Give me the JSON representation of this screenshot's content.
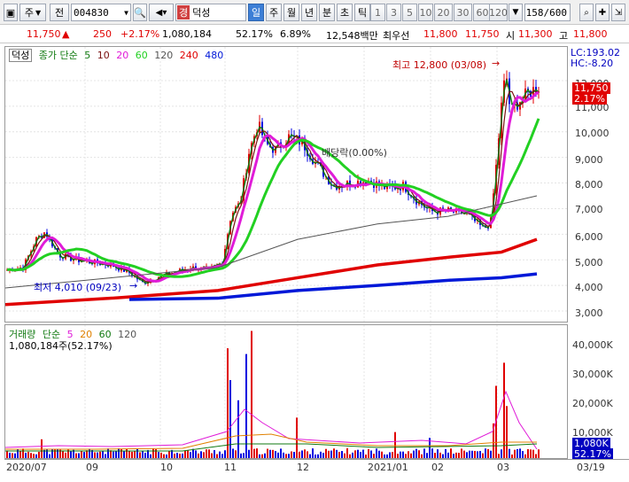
{
  "toolbar": {
    "window_label": "주",
    "market_label": "전",
    "stock_code": "004830",
    "tag": "경",
    "stock_name": "덕성",
    "period_tabs": [
      "일",
      "주",
      "월",
      "년",
      "분",
      "초",
      "틱"
    ],
    "interval_buttons": [
      "1",
      "3",
      "5",
      "10",
      "20",
      "30",
      "60",
      "120"
    ],
    "page_counter": "158",
    "page_total": "/600"
  },
  "infobar": {
    "price": "11,750",
    "change": "250",
    "change_pct": "+2.17%",
    "volume": "1,080,184",
    "volume_ratio": "52.17%",
    "turnover": "6.89%",
    "amount": "12,548백만",
    "bid_label": "최우선",
    "bid1": "11,800",
    "bid2": "11,750",
    "open_label": "시",
    "open": "11,300",
    "high_label": "고",
    "high": "11,800"
  },
  "price_panel": {
    "name_tag": "덕성",
    "ma_label": "종가 단순",
    "ma_periods": [
      "5",
      "10",
      "20",
      "60",
      "120",
      "240",
      "480"
    ],
    "lc_label": "LC:193.02",
    "hc_label": "HC:-8.20",
    "annotations": {
      "high": "최고 12,800 (03/08)",
      "low": "최저 4,010 (09/23)",
      "dividend": "배당락(0.00%)"
    },
    "current_price_tag": "11,750",
    "current_pct_tag": "2.17%",
    "y_ticks": [
      "12,000",
      "11,000",
      "10,000",
      "9,000",
      "8,000",
      "7,000",
      "6,000",
      "5,000",
      "4,000",
      "3,000"
    ]
  },
  "volume_panel": {
    "label": "거래량",
    "ma_label": "단순",
    "ma_periods": [
      "5",
      "20",
      "60",
      "120"
    ],
    "volume_text": "1,080,184주(52.17%)",
    "y_ticks": [
      "40,000K",
      "30,000K",
      "20,000K",
      "10,000K"
    ],
    "current_tag": "1,080K",
    "current_pct": "52.17%"
  },
  "x_axis": [
    "2020/07",
    "09",
    "10",
    "11",
    "12",
    "2021/01",
    "02",
    "03",
    "03/19"
  ],
  "colors": {
    "up": "#e00000",
    "down": "#0000e0",
    "ma5": "#117a11",
    "ma10": "#7a1111",
    "ma20": "#e01cd8",
    "ma60": "#22d022",
    "ma120": "#555555",
    "ma240": "#e00000",
    "ma480": "#0018d8"
  }
}
